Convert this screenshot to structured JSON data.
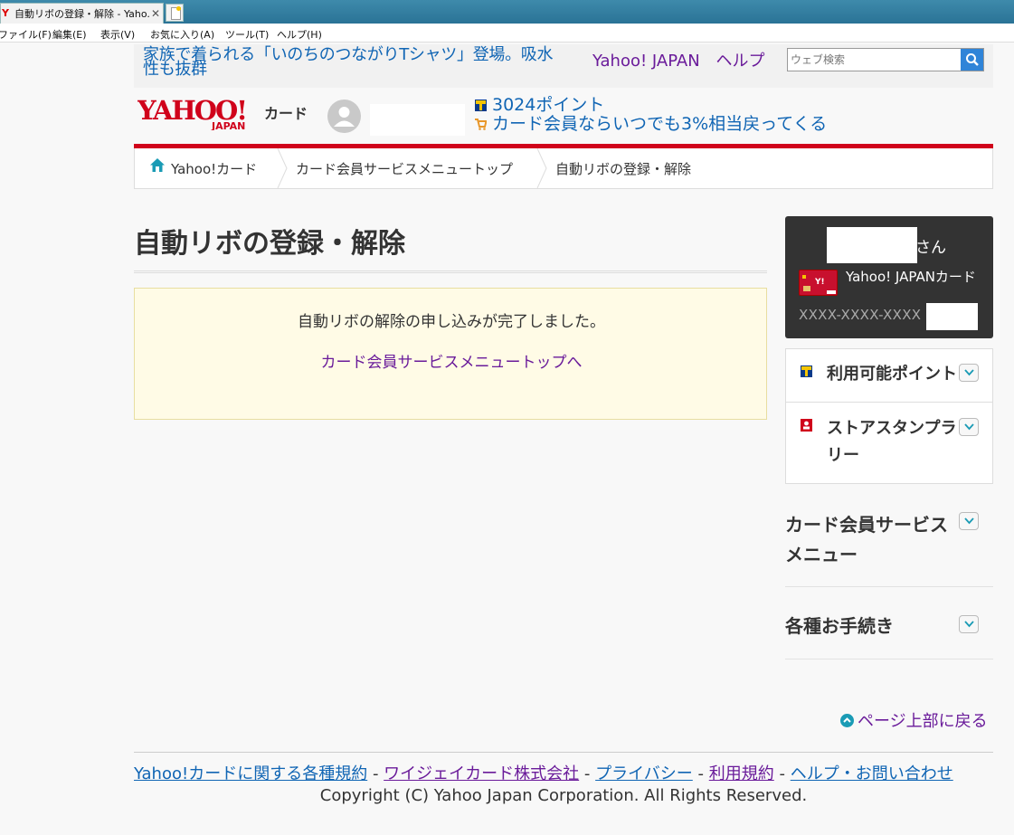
{
  "browser": {
    "tab_title": "自動リボの登録・解除 - Yaho...",
    "tab_close": "✕",
    "menu": [
      "ファイル(F)",
      "編集(E)",
      "表示(V)",
      "お気に入り(A)",
      "ツール(T)",
      "ヘルプ(H)"
    ]
  },
  "header": {
    "promo_text": "家族で着られる「いのちのつながりTシャツ」登場。吸水性も抜群",
    "links": [
      "Yahoo! JAPAN",
      "ヘルプ"
    ],
    "search_placeholder": "ウェブ検索",
    "logo_text": "YAHOO!",
    "logo_sub": "JAPAN",
    "logo_card": "カード",
    "points_text": "3024ポイント",
    "cashback_text": "カード会員ならいつでも3%相当戻ってくる"
  },
  "breadcrumb": {
    "items": [
      "Yahoo!カード",
      "カード会員サービスメニュートップ",
      "自動リボの登録・解除"
    ]
  },
  "main": {
    "title": "自動リボの登録・解除",
    "message": "自動リボの解除の申し込みが完了しました。",
    "link": "カード会員サービスメニュートップへ"
  },
  "sidebar": {
    "user_suffix": "さん",
    "card_name": "Yahoo! JAPANカード",
    "card_number": "XXXX-XXXX-XXXX",
    "accordion": [
      "利用可能ポイント",
      "ストアスタンプラリー"
    ],
    "sections": [
      "カード会員サービスメニュー",
      "各種お手続き"
    ]
  },
  "footer": {
    "page_top": "ページ上部に戻る",
    "links": [
      "Yahoo!カードに関する各種規約",
      "ワイジェイカード株式会社",
      "プライバシー",
      "利用規約",
      "ヘルプ・お問い合わせ"
    ],
    "separator": "-",
    "copyright": "Copyright (C) Yahoo Japan Corporation. All Rights Reserved."
  },
  "colors": {
    "brand_red": "#d0021b",
    "link_blue": "#1065b4",
    "visited_purple": "#6a1b9a",
    "notice_bg": "#fffbe6"
  }
}
